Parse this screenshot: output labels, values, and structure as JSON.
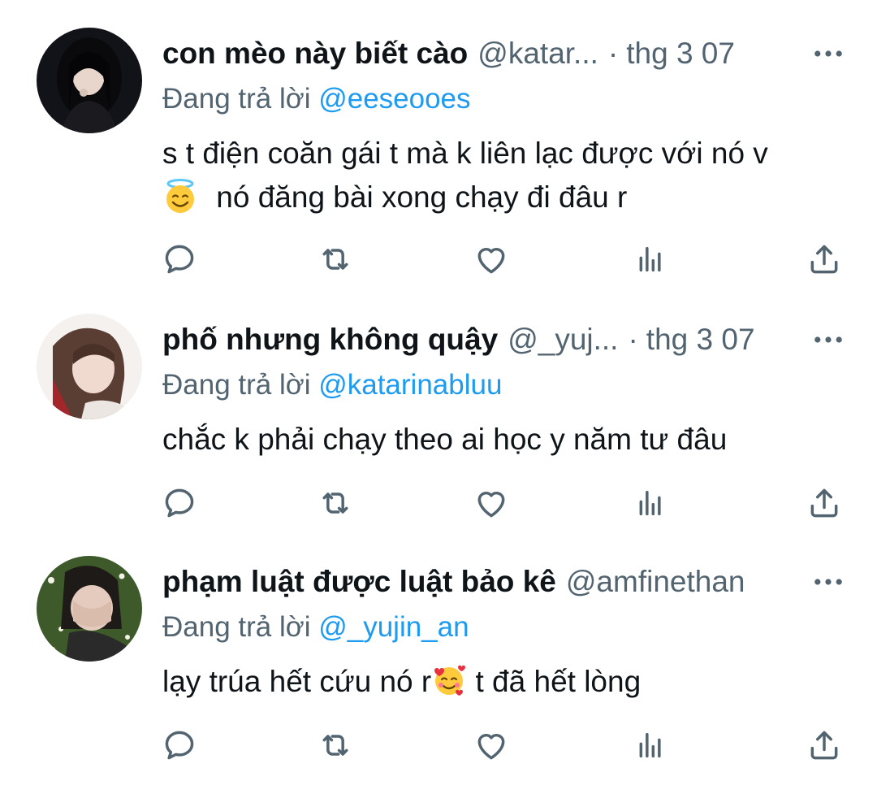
{
  "replies": [
    {
      "display_name": "con mèo này biết cào",
      "handle": "@katar...",
      "separator": "·",
      "time": "thg 3 07",
      "replying_prefix": "Đang trả lời ",
      "replying_to": "@eeseooes",
      "text_line1": "s t điện coăn gái t mà k liên lạc được với nó v",
      "text_line2": "nó đăng bài xong chạy đi đâu r",
      "emoji_icon": "smiling-face-with-halo-icon"
    },
    {
      "display_name": "phố nhưng không quậy",
      "handle": "@_yuj...",
      "separator": "·",
      "time": "thg 3 07",
      "replying_prefix": "Đang trả lời ",
      "replying_to": "@katarinabluu",
      "text_line1": "chắc k phải chạy theo ai học y năm tư đâu"
    },
    {
      "display_name": "phạm luật được luật bảo kê",
      "handle": "@amfinethan",
      "replying_prefix": "Đang trả lời ",
      "replying_to": "@_yujin_an",
      "text_before_emoji": "lạy trúa hết cứu nó r",
      "text_after_emoji": " t đã hết lòng",
      "emoji_icon": "smiling-face-with-hearts-icon"
    }
  ],
  "action_icons": [
    "reply-icon",
    "retweet-icon",
    "like-icon",
    "views-icon",
    "share-icon"
  ],
  "colors": {
    "text": "#0f1419",
    "secondary": "#536471",
    "link": "#1d9bf0",
    "background": "#ffffff"
  }
}
